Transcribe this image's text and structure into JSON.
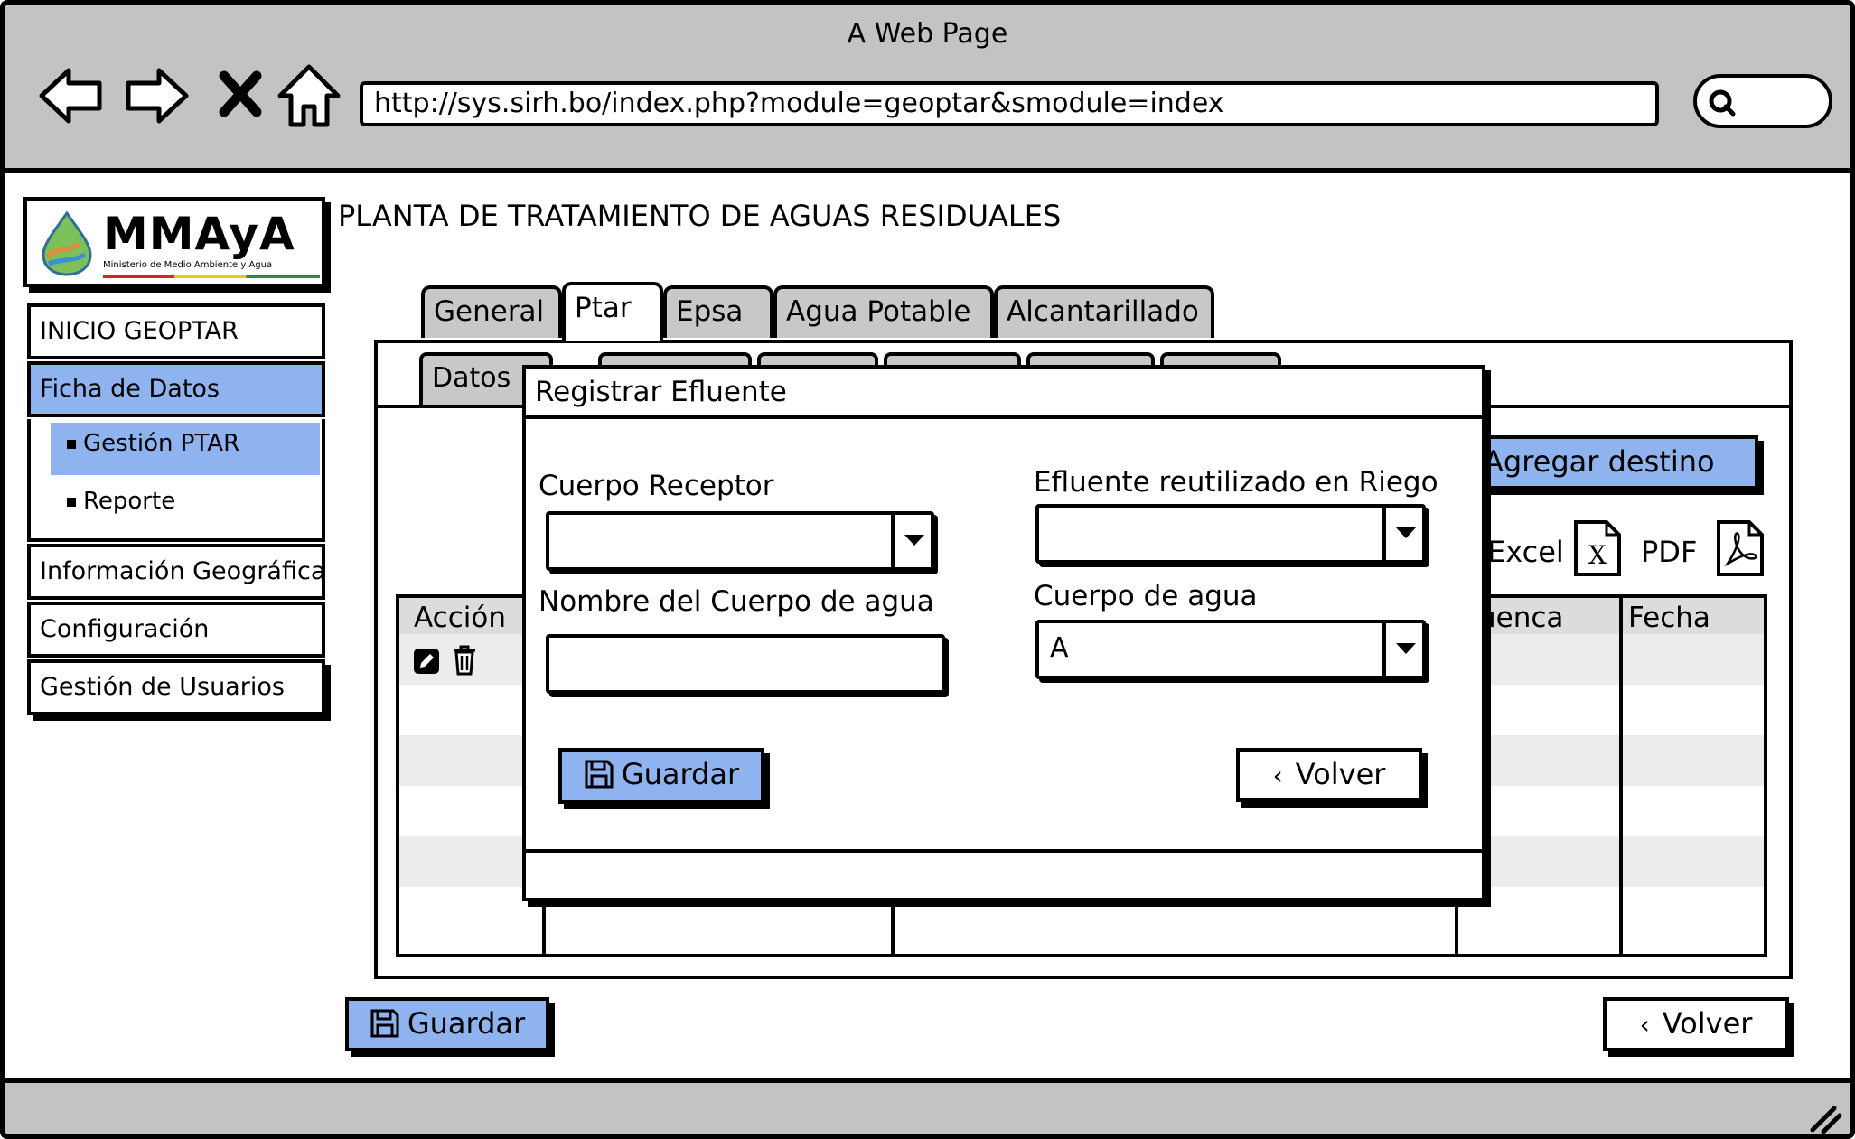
{
  "window": {
    "title": "A Web Page"
  },
  "browser": {
    "url": "http://sys.sirh.bo/index.php?module=geoptar&smodule=index",
    "icons": [
      "back-icon",
      "forward-icon",
      "close-icon",
      "home-icon",
      "search-icon"
    ]
  },
  "logo": {
    "name": "MMAyA",
    "subtitle": "Ministerio de Medio Ambiente y Agua"
  },
  "page": {
    "title": "PLANTA DE TRATAMIENTO DE AGUAS RESIDUALES"
  },
  "sidebar": {
    "items": [
      {
        "label": "INICIO GEOPTAR",
        "active": false
      },
      {
        "label": "Ficha de Datos",
        "active": true
      },
      {
        "label": "Gestión PTAR",
        "active": true,
        "sub": true
      },
      {
        "label": "Reporte",
        "active": false,
        "sub": true
      },
      {
        "label": "Información Geográfica",
        "active": false
      },
      {
        "label": "Configuración",
        "active": false
      },
      {
        "label": "Gestión de Usuarios",
        "active": false
      }
    ]
  },
  "tabs": [
    {
      "label": "General",
      "active": false
    },
    {
      "label": "Ptar",
      "active": true
    },
    {
      "label": "Epsa",
      "active": false
    },
    {
      "label": "Agua Potable",
      "active": false
    },
    {
      "label": "Alcantarillado",
      "active": false
    }
  ],
  "subtabs": {
    "first": "Datos"
  },
  "panel": {
    "add_button": "Agregar destino",
    "export_excel": "Excel",
    "export_pdf": "PDF",
    "table": {
      "headers": {
        "accion": "Acción",
        "cuenca": "uenca",
        "fecha": "Fecha"
      }
    }
  },
  "modal": {
    "title": "Registrar Efluente",
    "cuerpo_receptor_label": "Cuerpo Receptor",
    "cuerpo_receptor_value": "",
    "efluente_label": "Efluente reutilizado en Riego",
    "efluente_value": "",
    "nombre_label": "Nombre del Cuerpo de agua",
    "nombre_value": "",
    "cuerpo_agua_label": "Cuerpo de agua",
    "cuerpo_agua_value": "A",
    "save_button": "Guardar",
    "back_button": "Volver"
  },
  "footer": {
    "save_button": "Guardar",
    "back_button": "Volver"
  },
  "colors": {
    "primary": "#8fb3ee",
    "chrome": "#c3c3c3",
    "tab": "#c8c8c8"
  }
}
